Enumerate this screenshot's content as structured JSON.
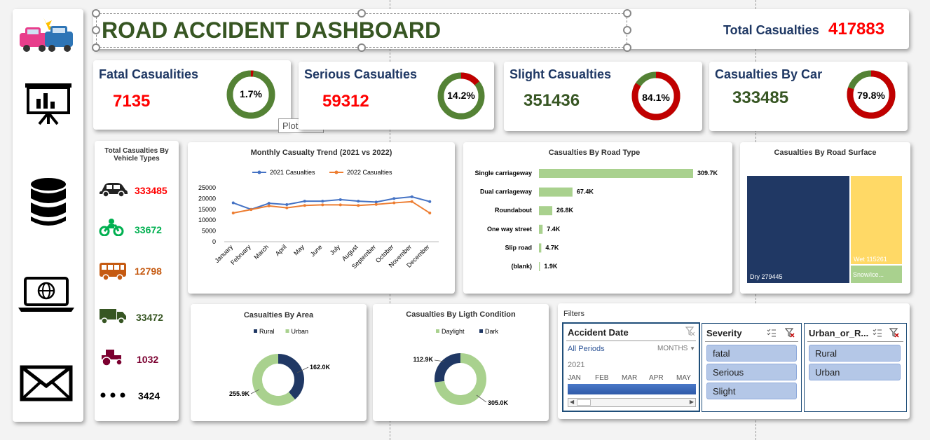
{
  "header": {
    "title": "ROAD ACCIDENT DASHBOARD",
    "total_label": "Total Casualties",
    "total_value": "417883"
  },
  "sidebar": {
    "icons": [
      "car-crash-icon",
      "presentation-chart-icon",
      "database-icon",
      "laptop-globe-icon",
      "envelope-icon"
    ]
  },
  "kpis": [
    {
      "title": "Fatal Casualities",
      "value": "7135",
      "pct_label": "1.7%",
      "pct": 0.017,
      "value_color": "#ff0000",
      "ring": "#548235",
      "seg": "#c00000"
    },
    {
      "title": "Serious Casualties",
      "value": "59312",
      "pct_label": "14.2%",
      "pct": 0.142,
      "value_color": "#ff0000",
      "ring": "#548235",
      "seg": "#c00000"
    },
    {
      "title": "Slight Casualties",
      "value": "351436",
      "pct_label": "84.1%",
      "pct": 0.841,
      "value_color": "#375623",
      "ring": "#548235",
      "seg": "#c00000"
    },
    {
      "title": "Casualties By Car",
      "value": "333485",
      "pct_label": "79.8%",
      "pct": 0.798,
      "value_color": "#375623",
      "ring": "#548235",
      "seg": "#c00000"
    }
  ],
  "tooltip": "Plot Area",
  "vehicles": {
    "title": "Total Casualties By Vehicle Types",
    "items": [
      {
        "icon": "car-icon",
        "value": "333485",
        "color": "#ff0000"
      },
      {
        "icon": "motorcycle-icon",
        "value": "33672",
        "color": "#00b050"
      },
      {
        "icon": "bus-icon",
        "value": "12798",
        "color": "#c55a11"
      },
      {
        "icon": "truck-icon",
        "value": "33472",
        "color": "#375623"
      },
      {
        "icon": "tractor-icon",
        "value": "1032",
        "color": "#7b0030"
      },
      {
        "icon": "more-icon",
        "value": "3424",
        "color": "#000000"
      }
    ]
  },
  "chart_data": [
    {
      "type": "line",
      "title": "Monthly Casualty Trend (2021 vs 2022)",
      "categories": [
        "January",
        "February",
        "March",
        "April",
        "May",
        "June",
        "July",
        "August",
        "September",
        "October",
        "November",
        "December"
      ],
      "series": [
        {
          "name": "2021 Casualties",
          "color": "#4472c4",
          "values": [
            18000,
            15000,
            17800,
            17200,
            18800,
            18800,
            19500,
            18800,
            18400,
            20000,
            20800,
            18600
          ]
        },
        {
          "name": "2022 Casualties",
          "color": "#ed7d31",
          "values": [
            13300,
            14900,
            16600,
            15700,
            16800,
            17100,
            17100,
            16800,
            17300,
            18000,
            18600,
            13300
          ]
        }
      ],
      "yticks": [
        "25000",
        "20000",
        "15000",
        "10000",
        "5000",
        "0"
      ],
      "ylim": [
        0,
        25000
      ]
    },
    {
      "type": "bar",
      "title": "Casualties By Road Type",
      "categories": [
        "Single carriageway",
        "Dual carriageway",
        "Roundabout",
        "One way street",
        "Slip road",
        "(blank)"
      ],
      "values": [
        309.7,
        67.4,
        26.8,
        7.4,
        4.7,
        1.9
      ],
      "labels": [
        "309.7K",
        "67.4K",
        "26.8K",
        "7.4K",
        "4.7K",
        "1.9K"
      ],
      "color": "#a9d18e"
    },
    {
      "type": "treemap",
      "title": "Casualties By Road Surface",
      "items": [
        {
          "label": "Dry 279445",
          "color": "#203864"
        },
        {
          "label": "Wet 115261",
          "color": "#ffd966"
        },
        {
          "label": "Snow/ice...",
          "color": "#a9d18e"
        }
      ]
    },
    {
      "type": "pie",
      "title": "Casualties By Area",
      "legend": [
        {
          "name": "Rural",
          "color": "#203864"
        },
        {
          "name": "Urban",
          "color": "#a9d18e"
        }
      ],
      "values": [
        162.0,
        255.9
      ],
      "labels": [
        "162.0K",
        "255.9K"
      ]
    },
    {
      "type": "pie",
      "title": "Casualties By Ligth Condition",
      "legend": [
        {
          "name": "Daylight",
          "color": "#a9d18e"
        },
        {
          "name": "Dark",
          "color": "#203864"
        }
      ],
      "values": [
        305.0,
        112.9
      ],
      "labels": [
        "305.0K",
        "112.9K"
      ]
    }
  ],
  "filters": {
    "title": "Filters",
    "date": {
      "title": "Accident Date",
      "all_periods": "All Periods",
      "level": "MONTHS",
      "year": "2021",
      "months": [
        "JAN",
        "FEB",
        "MAR",
        "APR",
        "MAY"
      ]
    },
    "severity": {
      "title": "Severity",
      "items": [
        "fatal",
        "Serious",
        "Slight"
      ]
    },
    "urban": {
      "title": "Urban_or_R...",
      "items": [
        "Rural",
        "Urban"
      ]
    }
  }
}
